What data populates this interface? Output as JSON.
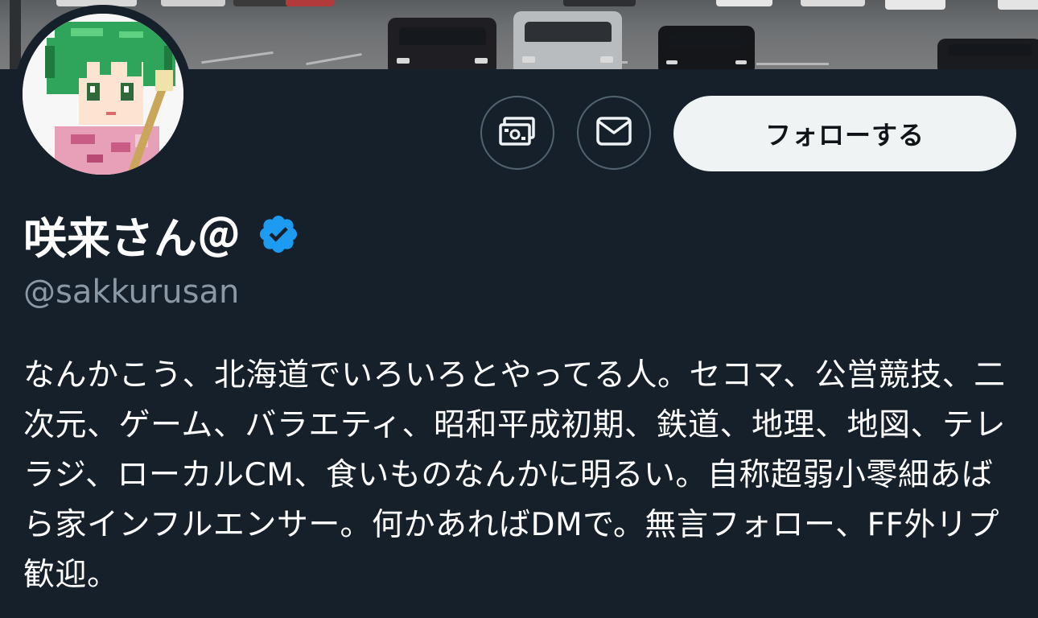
{
  "profile": {
    "display_name": "咲来さん＠",
    "verified": true,
    "handle": "@sakkurusan",
    "bio": "なんかこう、北海道でいろいろとやってる人。セコマ、公営競技、二次元、ゲーム、バラエティ、昭和平成初期、鉄道、地理、地図、テレラジ、ローカルCM、食いものなんかに明るい。自称超弱小零細あばら家インフルエンサー。何かあればDMで。無言フォロー、FF外リプ歓迎。"
  },
  "actions": {
    "tip_icon": "money-icon",
    "message_icon": "envelope-icon",
    "follow_label": "フォローする"
  },
  "colors": {
    "background": "#15202b",
    "follow_button_bg": "#eff3f4",
    "handle_text": "#8b98a5",
    "verified_badge": "#1d9bf0",
    "icon_button_border": "#536471"
  }
}
